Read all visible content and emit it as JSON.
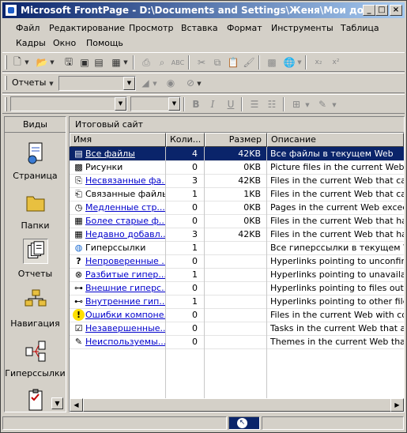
{
  "window": {
    "title": "Microsoft FrontPage - D:\\Documents and Settings\\Женя\\Мои документы\\..."
  },
  "menu": [
    "Файл",
    "Редактирование",
    "Просмотр",
    "Вставка",
    "Формат",
    "Инструменты",
    "Таблица",
    "Кадры",
    "Окно",
    "Помощь"
  ],
  "toolbar": {
    "reports_dropdown": "Отчеты"
  },
  "views": {
    "header": "Виды",
    "items": [
      {
        "label": "Страница",
        "icon": "page-icon"
      },
      {
        "label": "Папки",
        "icon": "folder-icon"
      },
      {
        "label": "Отчеты",
        "icon": "reports-icon",
        "selected": true
      },
      {
        "label": "Навигация",
        "icon": "navigation-icon"
      },
      {
        "label": "Гиперссылки",
        "icon": "hyperlinks-icon"
      },
      {
        "label": "",
        "icon": "tasks-icon"
      }
    ]
  },
  "report": {
    "title": "Итоговый сайт",
    "columns": [
      "Имя",
      "Коли...",
      "Размер",
      "Описание"
    ],
    "rows": [
      {
        "icon": "files-icon",
        "name": "Все файлы",
        "link": true,
        "count": "4",
        "size": "42KB",
        "desc": "Все файлы в текущем Web",
        "selected": true
      },
      {
        "icon": "picture-icon",
        "name": "Рисунки",
        "link": false,
        "count": "0",
        "size": "0KB",
        "desc": "Picture files in the current Web (GIF, JPG"
      },
      {
        "icon": "unlinked-files-icon",
        "name": "Несвязанные фа...",
        "link": true,
        "count": "3",
        "size": "42KB",
        "desc": "Files in the current Web that cannot be"
      },
      {
        "icon": "linked-files-icon",
        "name": "Связанные файлы",
        "link": false,
        "count": "1",
        "size": "1KB",
        "desc": "Files in the current Web that can be rea"
      },
      {
        "icon": "slow-pages-icon",
        "name": "Медленные стр...",
        "link": true,
        "count": "0",
        "size": "0KB",
        "desc": "Pages in the current Web exceeding"
      },
      {
        "icon": "older-files-icon",
        "name": "Более старые ф...",
        "link": true,
        "count": "0",
        "size": "0KB",
        "desc": "Files in the current Web that have not"
      },
      {
        "icon": "recent-files-icon",
        "name": "Недавно добавл...",
        "link": true,
        "count": "3",
        "size": "42KB",
        "desc": "Files in the current Web that have been"
      },
      {
        "icon": "globe-icon",
        "name": "Гиперссылки",
        "link": false,
        "count": "1",
        "size": "",
        "desc": "Все гиперссылки в текущем Web"
      },
      {
        "icon": "question-icon",
        "name": "Непроверенные ...",
        "link": true,
        "count": "0",
        "size": "",
        "desc": "Hyperlinks pointing to unconfirmed"
      },
      {
        "icon": "broken-link-icon",
        "name": "Разбитые гипер...",
        "link": true,
        "count": "1",
        "size": "",
        "desc": "Hyperlinks pointing to unavailable target"
      },
      {
        "icon": "external-link-icon",
        "name": "Внешние гиперс...",
        "link": true,
        "count": "0",
        "size": "",
        "desc": "Hyperlinks pointing to files outside of the"
      },
      {
        "icon": "internal-link-icon",
        "name": "Внутренние гип...",
        "link": true,
        "count": "1",
        "size": "",
        "desc": "Hyperlinks pointing to other files within"
      },
      {
        "icon": "error-icon",
        "name": "Ошибки компоне...",
        "link": true,
        "count": "0",
        "size": "",
        "desc": "Files in the current Web with componen"
      },
      {
        "icon": "tasks-small-icon",
        "name": "Незавершенные...",
        "link": true,
        "count": "0",
        "size": "",
        "desc": "Tasks in the current Web that are not"
      },
      {
        "icon": "themes-icon",
        "name": "Неиспользуемы...",
        "link": true,
        "count": "0",
        "size": "",
        "desc": "Themes in the current Web that are not"
      }
    ]
  }
}
